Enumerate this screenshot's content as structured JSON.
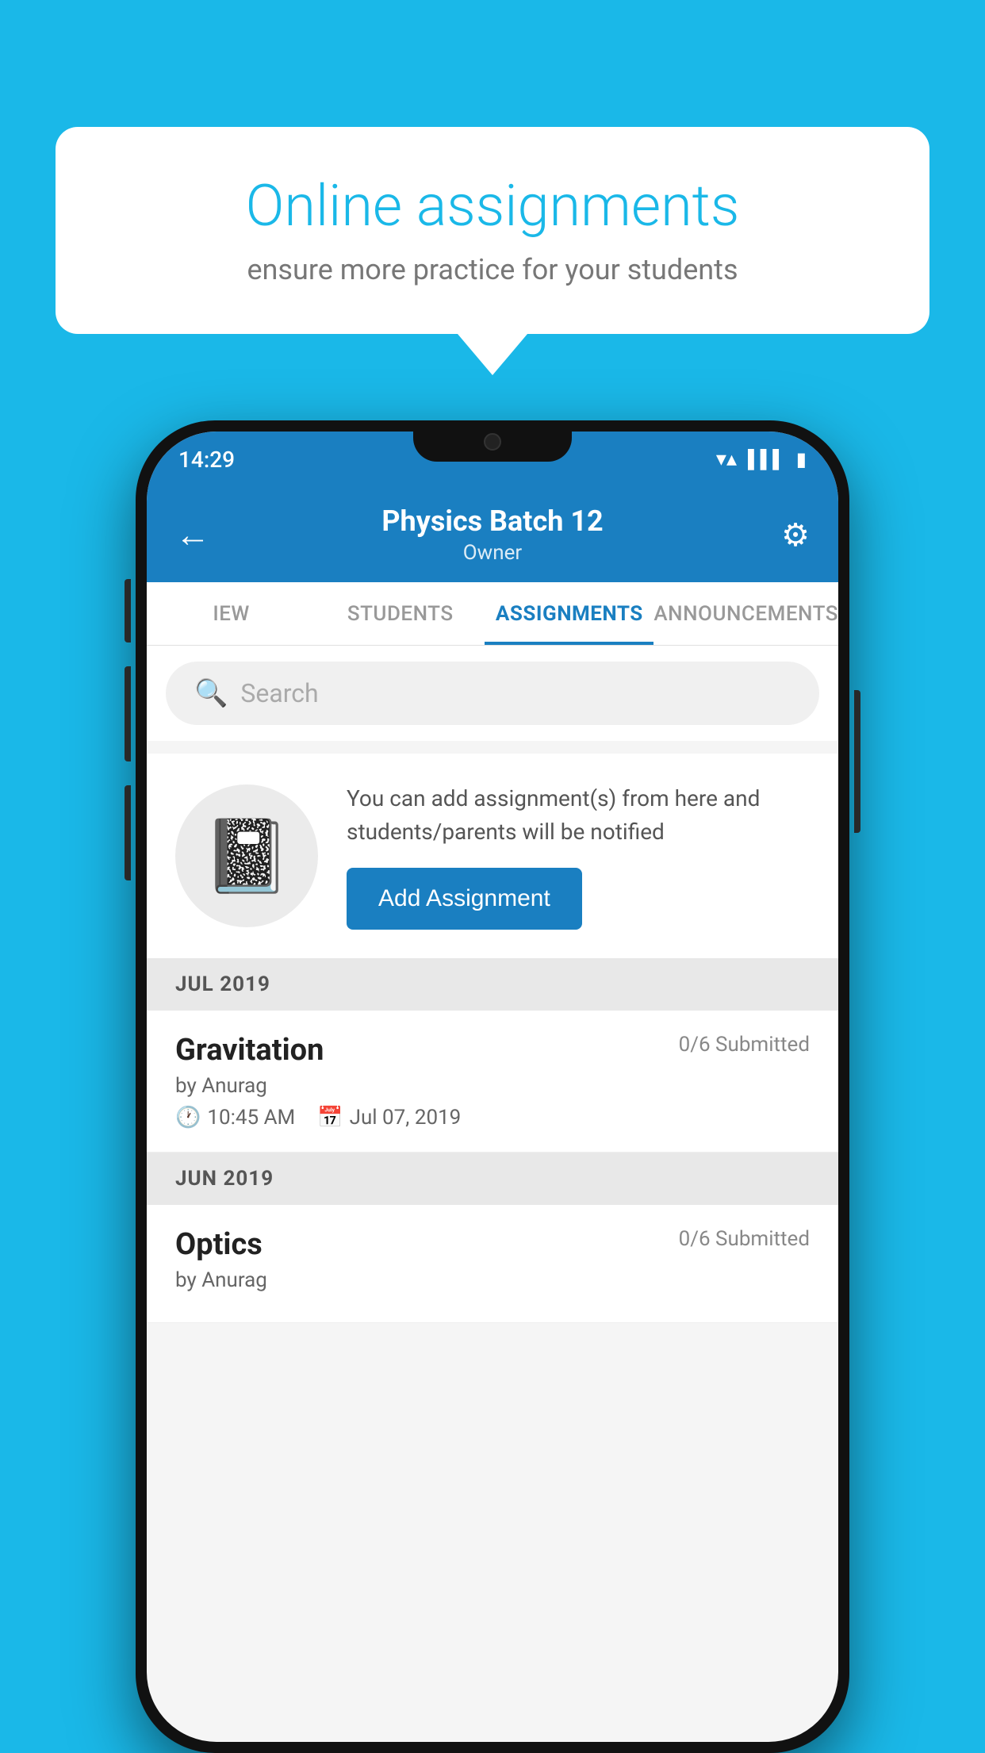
{
  "background_color": "#1ab8e8",
  "promo": {
    "title": "Online assignments",
    "subtitle": "ensure more practice for your students"
  },
  "phone": {
    "status_bar": {
      "time": "14:29"
    },
    "header": {
      "back_label": "←",
      "title": "Physics Batch 12",
      "subtitle": "Owner",
      "settings_label": "⚙"
    },
    "tabs": [
      {
        "label": "IEW",
        "active": false
      },
      {
        "label": "STUDENTS",
        "active": false
      },
      {
        "label": "ASSIGNMENTS",
        "active": true
      },
      {
        "label": "ANNOUNCEMENTS",
        "active": false
      }
    ],
    "search": {
      "placeholder": "Search"
    },
    "info_box": {
      "text": "You can add assignment(s) from here and students/parents will be notified",
      "button_label": "Add Assignment"
    },
    "sections": [
      {
        "header": "JUL 2019",
        "assignments": [
          {
            "name": "Gravitation",
            "submitted": "0/6 Submitted",
            "by": "by Anurag",
            "time": "10:45 AM",
            "date": "Jul 07, 2019"
          }
        ]
      },
      {
        "header": "JUN 2019",
        "assignments": [
          {
            "name": "Optics",
            "submitted": "0/6 Submitted",
            "by": "by Anurag",
            "time": "",
            "date": ""
          }
        ]
      }
    ]
  }
}
